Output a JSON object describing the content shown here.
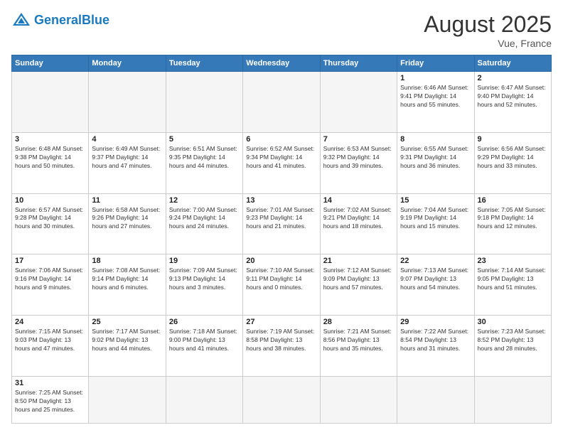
{
  "header": {
    "logo_general": "General",
    "logo_blue": "Blue",
    "month_title": "August 2025",
    "location": "Vue, France"
  },
  "days_of_week": [
    "Sunday",
    "Monday",
    "Tuesday",
    "Wednesday",
    "Thursday",
    "Friday",
    "Saturday"
  ],
  "weeks": [
    [
      {
        "day": "",
        "info": ""
      },
      {
        "day": "",
        "info": ""
      },
      {
        "day": "",
        "info": ""
      },
      {
        "day": "",
        "info": ""
      },
      {
        "day": "",
        "info": ""
      },
      {
        "day": "1",
        "info": "Sunrise: 6:46 AM\nSunset: 9:41 PM\nDaylight: 14 hours and 55 minutes."
      },
      {
        "day": "2",
        "info": "Sunrise: 6:47 AM\nSunset: 9:40 PM\nDaylight: 14 hours and 52 minutes."
      }
    ],
    [
      {
        "day": "3",
        "info": "Sunrise: 6:48 AM\nSunset: 9:38 PM\nDaylight: 14 hours and 50 minutes."
      },
      {
        "day": "4",
        "info": "Sunrise: 6:49 AM\nSunset: 9:37 PM\nDaylight: 14 hours and 47 minutes."
      },
      {
        "day": "5",
        "info": "Sunrise: 6:51 AM\nSunset: 9:35 PM\nDaylight: 14 hours and 44 minutes."
      },
      {
        "day": "6",
        "info": "Sunrise: 6:52 AM\nSunset: 9:34 PM\nDaylight: 14 hours and 41 minutes."
      },
      {
        "day": "7",
        "info": "Sunrise: 6:53 AM\nSunset: 9:32 PM\nDaylight: 14 hours and 39 minutes."
      },
      {
        "day": "8",
        "info": "Sunrise: 6:55 AM\nSunset: 9:31 PM\nDaylight: 14 hours and 36 minutes."
      },
      {
        "day": "9",
        "info": "Sunrise: 6:56 AM\nSunset: 9:29 PM\nDaylight: 14 hours and 33 minutes."
      }
    ],
    [
      {
        "day": "10",
        "info": "Sunrise: 6:57 AM\nSunset: 9:28 PM\nDaylight: 14 hours and 30 minutes."
      },
      {
        "day": "11",
        "info": "Sunrise: 6:58 AM\nSunset: 9:26 PM\nDaylight: 14 hours and 27 minutes."
      },
      {
        "day": "12",
        "info": "Sunrise: 7:00 AM\nSunset: 9:24 PM\nDaylight: 14 hours and 24 minutes."
      },
      {
        "day": "13",
        "info": "Sunrise: 7:01 AM\nSunset: 9:23 PM\nDaylight: 14 hours and 21 minutes."
      },
      {
        "day": "14",
        "info": "Sunrise: 7:02 AM\nSunset: 9:21 PM\nDaylight: 14 hours and 18 minutes."
      },
      {
        "day": "15",
        "info": "Sunrise: 7:04 AM\nSunset: 9:19 PM\nDaylight: 14 hours and 15 minutes."
      },
      {
        "day": "16",
        "info": "Sunrise: 7:05 AM\nSunset: 9:18 PM\nDaylight: 14 hours and 12 minutes."
      }
    ],
    [
      {
        "day": "17",
        "info": "Sunrise: 7:06 AM\nSunset: 9:16 PM\nDaylight: 14 hours and 9 minutes."
      },
      {
        "day": "18",
        "info": "Sunrise: 7:08 AM\nSunset: 9:14 PM\nDaylight: 14 hours and 6 minutes."
      },
      {
        "day": "19",
        "info": "Sunrise: 7:09 AM\nSunset: 9:13 PM\nDaylight: 14 hours and 3 minutes."
      },
      {
        "day": "20",
        "info": "Sunrise: 7:10 AM\nSunset: 9:11 PM\nDaylight: 14 hours and 0 minutes."
      },
      {
        "day": "21",
        "info": "Sunrise: 7:12 AM\nSunset: 9:09 PM\nDaylight: 13 hours and 57 minutes."
      },
      {
        "day": "22",
        "info": "Sunrise: 7:13 AM\nSunset: 9:07 PM\nDaylight: 13 hours and 54 minutes."
      },
      {
        "day": "23",
        "info": "Sunrise: 7:14 AM\nSunset: 9:05 PM\nDaylight: 13 hours and 51 minutes."
      }
    ],
    [
      {
        "day": "24",
        "info": "Sunrise: 7:15 AM\nSunset: 9:03 PM\nDaylight: 13 hours and 47 minutes."
      },
      {
        "day": "25",
        "info": "Sunrise: 7:17 AM\nSunset: 9:02 PM\nDaylight: 13 hours and 44 minutes."
      },
      {
        "day": "26",
        "info": "Sunrise: 7:18 AM\nSunset: 9:00 PM\nDaylight: 13 hours and 41 minutes."
      },
      {
        "day": "27",
        "info": "Sunrise: 7:19 AM\nSunset: 8:58 PM\nDaylight: 13 hours and 38 minutes."
      },
      {
        "day": "28",
        "info": "Sunrise: 7:21 AM\nSunset: 8:56 PM\nDaylight: 13 hours and 35 minutes."
      },
      {
        "day": "29",
        "info": "Sunrise: 7:22 AM\nSunset: 8:54 PM\nDaylight: 13 hours and 31 minutes."
      },
      {
        "day": "30",
        "info": "Sunrise: 7:23 AM\nSunset: 8:52 PM\nDaylight: 13 hours and 28 minutes."
      }
    ],
    [
      {
        "day": "31",
        "info": "Sunrise: 7:25 AM\nSunset: 8:50 PM\nDaylight: 13 hours and 25 minutes."
      },
      {
        "day": "",
        "info": ""
      },
      {
        "day": "",
        "info": ""
      },
      {
        "day": "",
        "info": ""
      },
      {
        "day": "",
        "info": ""
      },
      {
        "day": "",
        "info": ""
      },
      {
        "day": "",
        "info": ""
      }
    ]
  ]
}
